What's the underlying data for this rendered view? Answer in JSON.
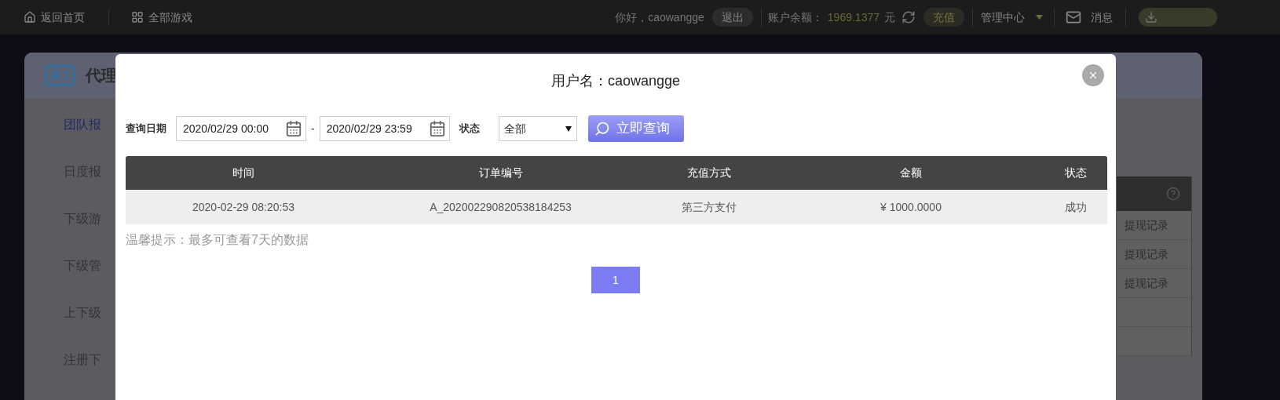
{
  "top_bar": {
    "nav_links": [
      {
        "kind": "home",
        "label": "返回首页"
      },
      {
        "kind": "grid",
        "label": "全部游戏"
      }
    ],
    "greeting": "你好，caowangge",
    "logout": "退出",
    "balance_label": "账户余额：",
    "balance": "1969.1377",
    "currency": "元",
    "recharge": "充值",
    "admin_menu": "管理中心",
    "messages": "消息"
  },
  "background_panel": {
    "title": "代理",
    "menu": [
      {
        "label": "团队报",
        "selected": true
      },
      {
        "label": "日度报",
        "selected": false
      },
      {
        "label": "下级游",
        "selected": false
      },
      {
        "label": "下级管",
        "selected": false
      },
      {
        "label": "上下级",
        "selected": false
      },
      {
        "label": "注册下",
        "selected": false
      }
    ],
    "side_table_rows": [
      "提现记录",
      "提现记录",
      "提现记录"
    ]
  },
  "dialog": {
    "title": "用户名：caowangge",
    "filters": {
      "date_label": "查询日期",
      "start": "2020/02/29 00:00",
      "separator": "-",
      "end": "2020/02/29 23:59",
      "status_label": "状态",
      "status_value": "全部",
      "query_button": "立即查询"
    },
    "table": {
      "columns": [
        "时间",
        "订单编号",
        "充值方式",
        "金额",
        "状态"
      ],
      "rows": [
        [
          "2020-02-29 08:20:53",
          "A_202002290820538184253",
          "第三方支付",
          "¥ 1000.0000",
          "成功"
        ]
      ]
    },
    "hint": "温馨提示：最多可查看7天的数据",
    "pagination": [
      {
        "label": "1",
        "selected": true
      }
    ]
  }
}
